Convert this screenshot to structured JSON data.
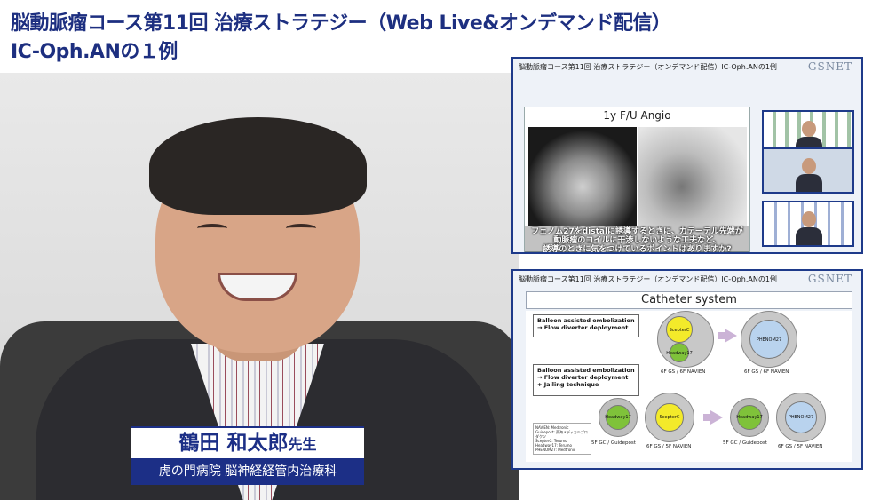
{
  "header": {
    "title_line1": "脳動脈瘤コース第11回 治療ストラテジー（Web Live&オンデマンド配信）",
    "title_line2": "IC-Oph.ANの１例"
  },
  "speaker": {
    "name": "鶴田 和太郎",
    "honorific": "先生",
    "affiliation": "虎の門病院 脳神経経管内治療科"
  },
  "slide_top": {
    "header": "脳動脈瘤コース第11回 治療ストラテジー（オンデマンド配信）IC-Oph.ANの1例",
    "logo": "GSNET",
    "image_title": "1y F/U Angio",
    "caption_line1": "フェノム27をdistalに誘導するときに、カテーテル先端が",
    "caption_line2": "動脈瘤のコイルに干渉しないような工夫など、",
    "caption_line3": "誘導のときに気をつけているポイントはありますか?"
  },
  "slide_bottom": {
    "header": "脳動脈瘤コース第11回 治療ストラテジー（オンデマンド配信）IC-Oph.ANの1例",
    "logo": "GSNET",
    "title": "Catheter system",
    "box1_line1": "Balloon assisted embolization",
    "box1_line2": "→  Flow diverter deployment",
    "box2_line1": "Balloon assisted embolization",
    "box2_line2": "→  Flow diverter deployment",
    "box2_line3": "+ Jailing technique",
    "catheters": {
      "scepter": "ScepterC",
      "headway": "Headway17",
      "phenom": "PHENOM27"
    },
    "labels": {
      "r1_left": "6F GS / 6F NAVIEN",
      "r1_right": "6F GS / 6F NAVIEN",
      "r2_a": "5F GC / Guidepost",
      "r2_b": "6F GS / 5F NAVIEN",
      "r2_c": "5F GC / Guidepost",
      "r2_d": "6F GS / 5F NAVIEN"
    },
    "legend": [
      "NAVIEN: Medtronic",
      "Guidepost: 東海メディカルプロダクツ",
      "ScepterC: Terumo",
      "Headway17: Terumo",
      "PHENOM27: Medtronic"
    ]
  },
  "colors": {
    "title_blue": "#1d2f80",
    "nameplate_blue": "#1c2f86",
    "scepter_yellow": "#f3ea2a",
    "headway_green": "#7fc23a",
    "phenom_blue": "#b9d3ee"
  }
}
